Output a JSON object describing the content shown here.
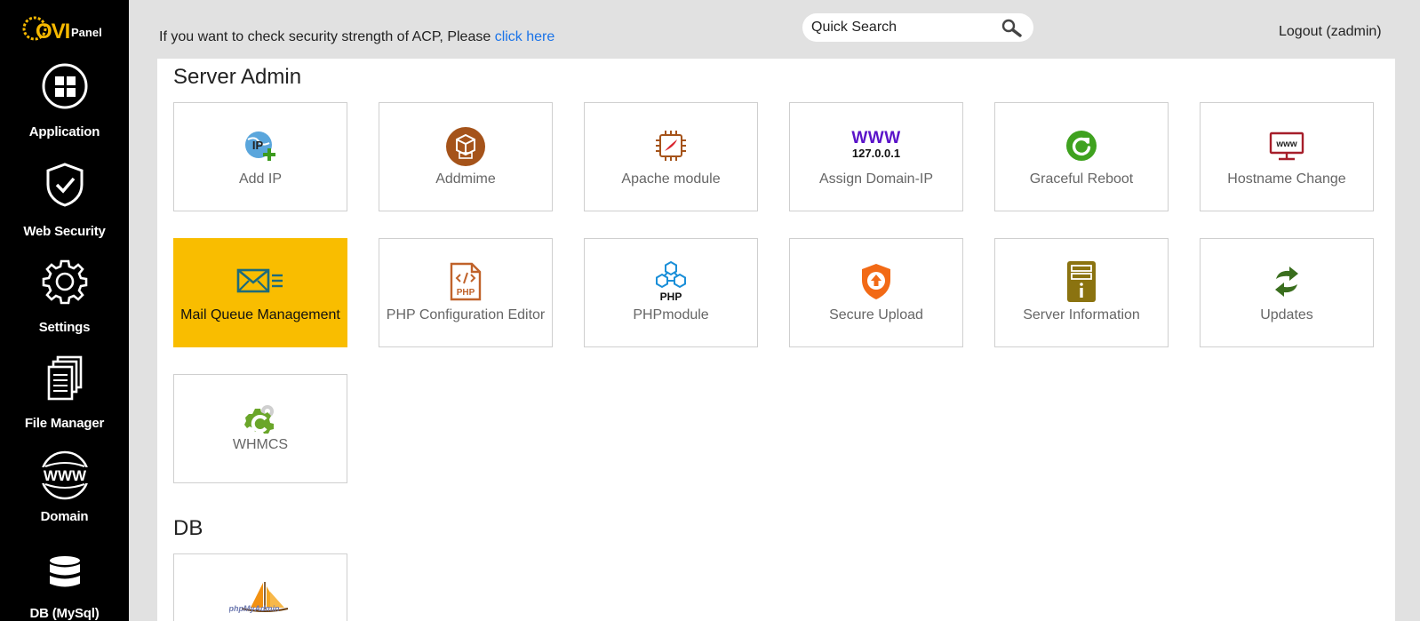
{
  "brand": {
    "logo_text": "OVI",
    "logo_sub": "Panel"
  },
  "sidebar": {
    "items": [
      {
        "label": "Application",
        "icon": "grid-icon"
      },
      {
        "label": "Web Security",
        "icon": "shield-check-icon"
      },
      {
        "label": "Settings",
        "icon": "gear-icon"
      },
      {
        "label": "File Manager",
        "icon": "documents-icon"
      },
      {
        "label": "Domain",
        "icon": "www-icon"
      },
      {
        "label": "DB (MySql)",
        "icon": "database-icon"
      }
    ]
  },
  "header": {
    "notice_text": "If you want to check security strength of ACP, Please ",
    "notice_link": "click here",
    "search_placeholder": "Quick Search",
    "logout_label": "Logout (zadmin)"
  },
  "sections": [
    {
      "title": "Server Admin",
      "tiles": [
        {
          "label": "Add IP",
          "icon": "ip-add-icon"
        },
        {
          "label": "Addmime",
          "icon": "addmime-icon"
        },
        {
          "label": "Apache module",
          "icon": "apache-module-icon"
        },
        {
          "label": "Assign Domain-IP",
          "icon": "www-ip-icon",
          "icon_text_top": "WWW",
          "icon_text_bottom": "127.0.0.1"
        },
        {
          "label": "Graceful Reboot",
          "icon": "reboot-icon"
        },
        {
          "label": "Hostname Change",
          "icon": "monitor-www-icon",
          "icon_text": "www"
        },
        {
          "label": "Mail Queue Management",
          "icon": "mail-queue-icon",
          "active": true
        },
        {
          "label": "PHP Configuration Editor",
          "icon": "php-file-icon",
          "icon_text": "PHP"
        },
        {
          "label": "PHPmodule",
          "icon": "php-module-icon",
          "icon_text": "PHP"
        },
        {
          "label": "Secure Upload",
          "icon": "secure-upload-icon"
        },
        {
          "label": "Server Information",
          "icon": "server-info-icon"
        },
        {
          "label": "Updates",
          "icon": "updates-icon"
        },
        {
          "label": "WHMCS",
          "icon": "whmcs-icon"
        }
      ]
    },
    {
      "title": "DB",
      "tiles": [
        {
          "label": "phpMyAdmin",
          "icon": "phpmyadmin-icon",
          "icon_text": "phpMyAdmin"
        }
      ]
    }
  ],
  "colors": {
    "sidebar_bg": "#000000",
    "page_bg": "#e1e1e1",
    "active_tile": "#f9bd00",
    "link": "#1a73e8",
    "logo": "#f5b800"
  }
}
